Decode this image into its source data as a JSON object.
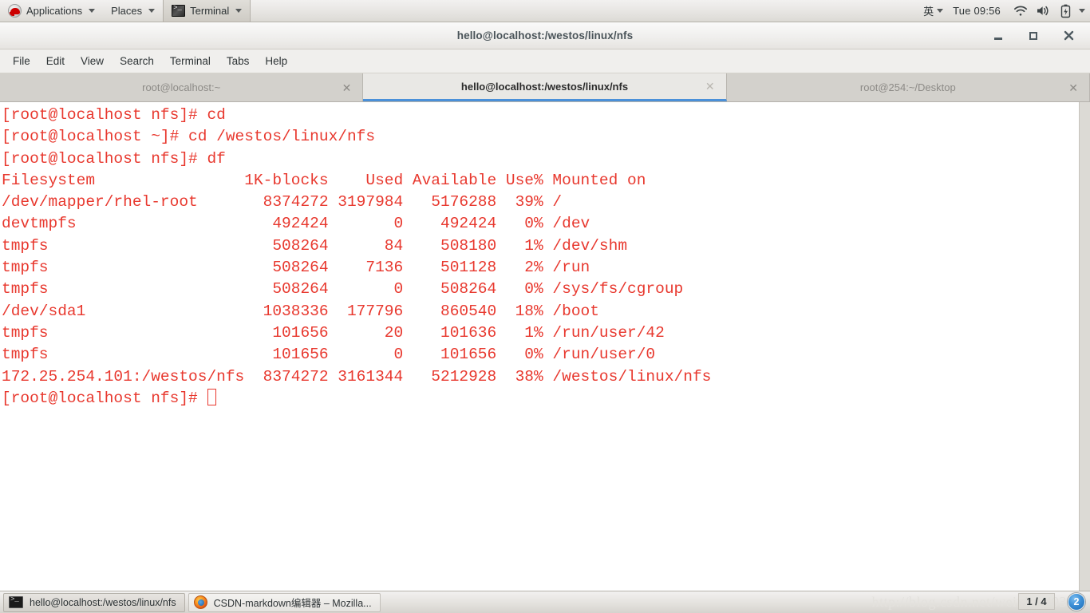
{
  "top_panel": {
    "applications_menu": "Applications",
    "places_menu": "Places",
    "active_window_menu": "Terminal",
    "ime_indicator": "英",
    "clock": "Tue 09:56",
    "tray": {
      "wifi_icon": "wifi-icon",
      "volume_icon": "volume-icon",
      "battery_icon": "battery-icon",
      "system_menu_icon": "chevron-down-icon"
    }
  },
  "window": {
    "title": "hello@localhost:/westos/linux/nfs",
    "controls": {
      "minimize": "–",
      "maximize": "□",
      "close": "✕"
    }
  },
  "menubar": {
    "items": [
      "File",
      "Edit",
      "View",
      "Search",
      "Terminal",
      "Tabs",
      "Help"
    ]
  },
  "tabs": [
    {
      "label": "root@localhost:~",
      "active": false,
      "close": "✕"
    },
    {
      "label": "hello@localhost:/westos/linux/nfs",
      "active": true,
      "close": "✕"
    },
    {
      "label": "root@254:~/Desktop",
      "active": false,
      "close": "✕"
    }
  ],
  "terminal": {
    "foreground_color": "#e8382e",
    "background_color": "#ffffff",
    "lines": [
      "[root@localhost nfs]# cd",
      "[root@localhost ~]# cd /westos/linux/nfs",
      "[root@localhost nfs]# df",
      "Filesystem                1K-blocks    Used Available Use% Mounted on",
      "/dev/mapper/rhel-root       8374272 3197984   5176288  39% /",
      "devtmpfs                     492424       0    492424   0% /dev",
      "tmpfs                        508264      84    508180   1% /dev/shm",
      "tmpfs                        508264    7136    501128   2% /run",
      "tmpfs                        508264       0    508264   0% /sys/fs/cgroup",
      "/dev/sda1                   1038336  177796    860540  18% /boot",
      "tmpfs                        101656      20    101636   1% /run/user/42",
      "tmpfs                        101656       0    101656   0% /run/user/0",
      "172.25.254.101:/westos/nfs  8374272 3161344   5212928  38% /westos/linux/nfs"
    ],
    "prompt": "[root@localhost nfs]# ",
    "df_table": {
      "headers": [
        "Filesystem",
        "1K-blocks",
        "Used",
        "Available",
        "Use%",
        "Mounted on"
      ],
      "rows": [
        [
          "/dev/mapper/rhel-root",
          "8374272",
          "3197984",
          "5176288",
          "39%",
          "/"
        ],
        [
          "devtmpfs",
          "492424",
          "0",
          "492424",
          "0%",
          "/dev"
        ],
        [
          "tmpfs",
          "508264",
          "84",
          "508180",
          "1%",
          "/dev/shm"
        ],
        [
          "tmpfs",
          "508264",
          "7136",
          "501128",
          "2%",
          "/run"
        ],
        [
          "tmpfs",
          "508264",
          "0",
          "508264",
          "0%",
          "/sys/fs/cgroup"
        ],
        [
          "/dev/sda1",
          "1038336",
          "177796",
          "860540",
          "18%",
          "/boot"
        ],
        [
          "tmpfs",
          "101656",
          "20",
          "101636",
          "1%",
          "/run/user/42"
        ],
        [
          "tmpfs",
          "101656",
          "0",
          "101656",
          "0%",
          "/run/user/0"
        ],
        [
          "172.25.254.101:/westos/nfs",
          "8374272",
          "3161344",
          "5212928",
          "38%",
          "/westos/linux/nfs"
        ]
      ]
    }
  },
  "bottom_panel": {
    "tasks": [
      {
        "label": "hello@localhost:/westos/linux/nfs",
        "icon": "terminal-icon",
        "active": true
      },
      {
        "label": "CSDN-markdown编辑器 – Mozilla...",
        "icon": "firefox-icon",
        "active": false
      }
    ],
    "watermark": "http://blog.csdn.net/weixin_40388",
    "workspace_indicator": "1 / 4",
    "notification_count": "2"
  }
}
